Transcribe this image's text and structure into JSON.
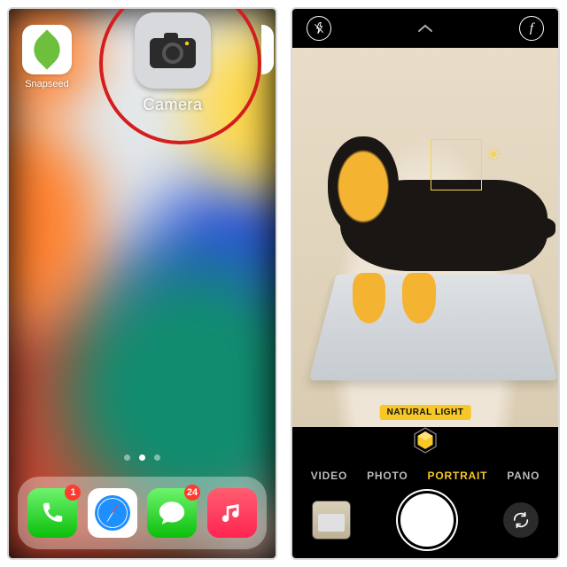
{
  "home": {
    "apps": {
      "snapseed": {
        "label": "Snapseed"
      },
      "camera": {
        "label": "Camera"
      }
    },
    "dock": {
      "phone": {
        "badge": "1"
      },
      "messages": {
        "badge": "24"
      }
    },
    "page_indicator": {
      "count": 3,
      "active_index": 1
    }
  },
  "camera": {
    "lighting_label": "NATURAL LIGHT",
    "modes": {
      "video": "VIDEO",
      "photo": "PHOTO",
      "portrait": "PORTRAIT",
      "pano": "PANO"
    },
    "active_mode": "portrait",
    "top_controls": {
      "flash": "off",
      "filter_letter": "f"
    }
  }
}
